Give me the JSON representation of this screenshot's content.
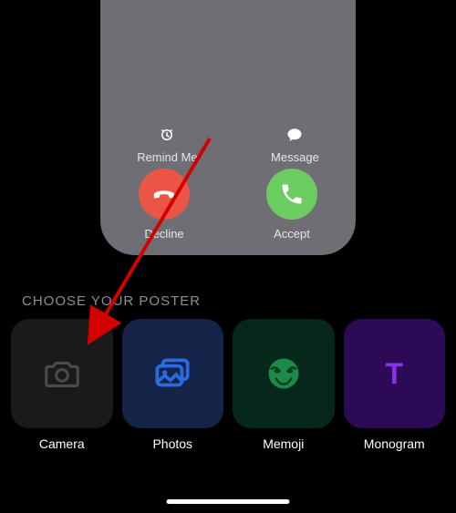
{
  "call_preview": {
    "remind_label": "Remind Me",
    "message_label": "Message",
    "decline_label": "Decline",
    "accept_label": "Accept",
    "colors": {
      "decline": "#eb5545",
      "accept": "#6bcd5f"
    }
  },
  "heading": "CHOOSE YOUR POSTER",
  "posters": {
    "camera": {
      "label": "Camera",
      "icon": "camera-icon",
      "bg": "#1a1a1a"
    },
    "photos": {
      "label": "Photos",
      "icon": "photos-icon",
      "bg": "#142448"
    },
    "memoji": {
      "label": "Memoji",
      "icon": "memoji-icon",
      "bg": "#06281a"
    },
    "monogram": {
      "label": "Monogram",
      "letter": "T",
      "bg": "#2d0a55",
      "letter_color": "#8734e8"
    }
  }
}
